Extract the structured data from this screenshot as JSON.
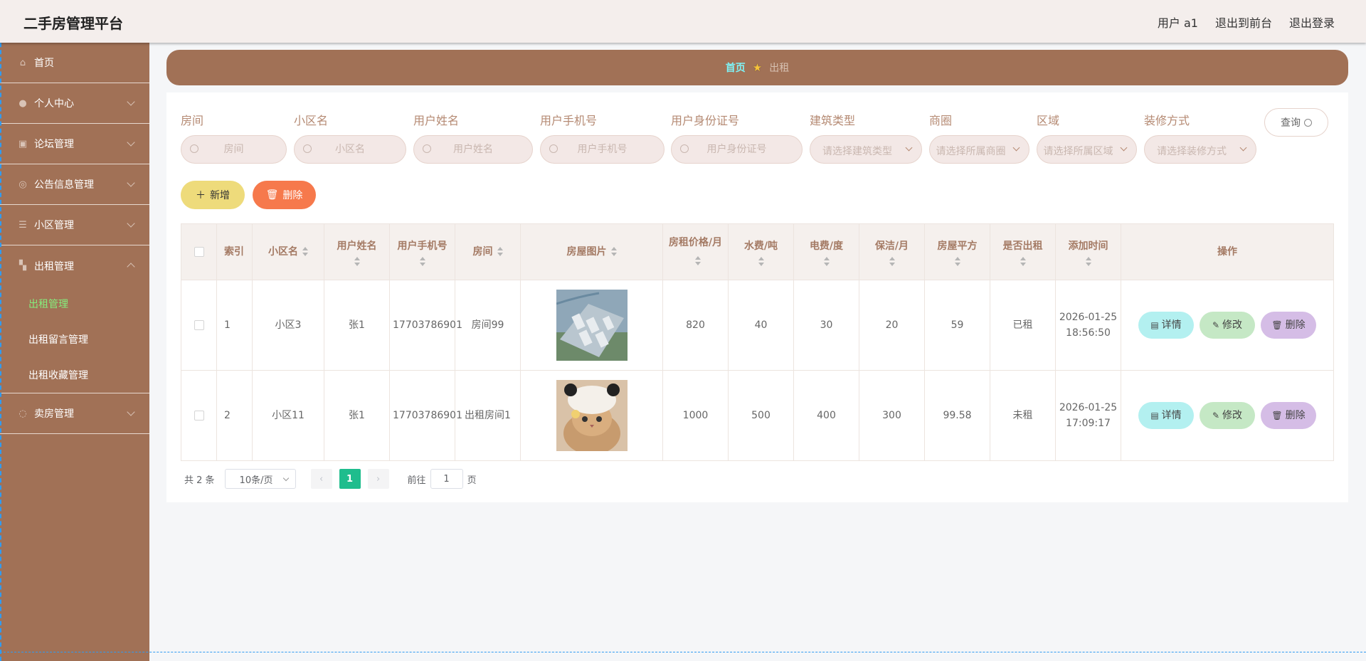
{
  "app": {
    "title": "二手房管理平台",
    "user_label": "用户 a1",
    "front_link": "退出到前台",
    "logout_link": "退出登录"
  },
  "sidebar": {
    "items": [
      {
        "label": "首页",
        "icon": "home-icon"
      },
      {
        "label": "个人中心",
        "icon": "user-icon"
      },
      {
        "label": "论坛管理",
        "icon": "forum-icon"
      },
      {
        "label": "公告信息管理",
        "icon": "notice-icon"
      },
      {
        "label": "小区管理",
        "icon": "list-icon"
      },
      {
        "label": "出租管理",
        "icon": "rent-icon"
      },
      {
        "label": "卖房管理",
        "icon": "sell-icon"
      }
    ],
    "rent_sub": [
      "出租管理",
      "出租留言管理",
      "出租收藏管理"
    ]
  },
  "breadcrumb": {
    "home": "首页",
    "current": "出租"
  },
  "search": {
    "fields": [
      {
        "label": "房间",
        "placeholder": "房间"
      },
      {
        "label": "小区名",
        "placeholder": "小区名"
      },
      {
        "label": "用户姓名",
        "placeholder": "用户姓名"
      },
      {
        "label": "用户手机号",
        "placeholder": "用户手机号"
      },
      {
        "label": "用户身份证号",
        "placeholder": "用户身份证号"
      }
    ],
    "selects": [
      {
        "label": "建筑类型",
        "placeholder": "请选择建筑类型"
      },
      {
        "label": "商圈",
        "placeholder": "请选择所属商圈"
      },
      {
        "label": "区域",
        "placeholder": "请选择所属区域"
      },
      {
        "label": "装修方式",
        "placeholder": "请选择装修方式"
      }
    ],
    "query_label": "查询"
  },
  "actions": {
    "add_label": "新增",
    "delete_label": "删除"
  },
  "table": {
    "headers": [
      "索引",
      "小区名",
      "用户姓名",
      "用户手机号",
      "房间",
      "房屋图片",
      "房租价格/月",
      "水费/吨",
      "电费/度",
      "保洁/月",
      "房屋平方",
      "是否出租",
      "添加时间",
      "操作"
    ],
    "rows": [
      {
        "index": "1",
        "community": "小区3",
        "name": "张1",
        "phone": "17703786901",
        "room": "房间99",
        "image": "aerial-residential-complex",
        "price": "820",
        "water": "40",
        "power": "30",
        "clean": "20",
        "area": "59",
        "rented": "已租",
        "time": "2026-01-25 18:56:50"
      },
      {
        "index": "2",
        "community": "小区11",
        "name": "张1",
        "phone": "17703786901",
        "room": "出租房间1",
        "image": "cat-in-panda-hat",
        "price": "1000",
        "water": "500",
        "power": "400",
        "clean": "300",
        "area": "99.58",
        "rented": "未租",
        "time": "2026-01-25 17:09:17"
      }
    ],
    "row_actions": {
      "detail": "详情",
      "edit": "修改",
      "delete": "删除"
    }
  },
  "pagination": {
    "total": "共 2 条",
    "page_size": "10条/页",
    "current_page": "1",
    "goto_prefix": "前往",
    "goto_value": "1",
    "goto_suffix": "页"
  }
}
